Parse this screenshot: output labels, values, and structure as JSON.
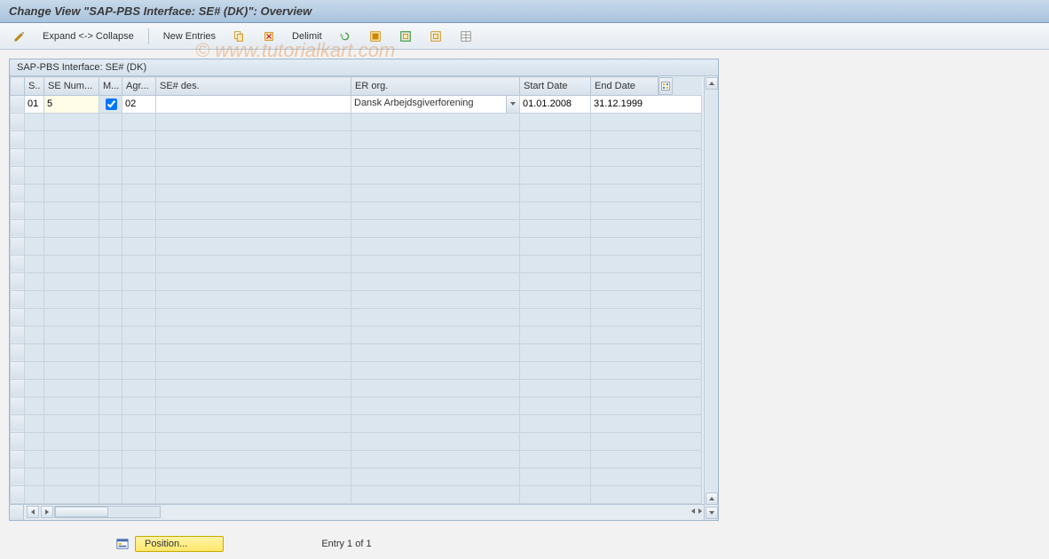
{
  "title": "Change View \"SAP-PBS Interface: SE# (DK)\": Overview",
  "toolbar": {
    "expand_collapse": "Expand <-> Collapse",
    "new_entries": "New Entries",
    "delimit": "Delimit"
  },
  "grid": {
    "title": "SAP-PBS Interface: SE# (DK)",
    "columns": [
      "S..",
      "SE Num...",
      "M...",
      "Agr...",
      "SE# des.",
      "ER org.",
      "Start Date",
      "End Date"
    ],
    "row": {
      "s": "01",
      "se_num": "5",
      "m_checked": true,
      "agr": "02",
      "se_des": "",
      "er_org": "Dansk Arbejdsgiverforening",
      "start_date": "01.01.2008",
      "end_date": "31.12.1999"
    },
    "empty_rows": 22
  },
  "footer": {
    "position_label": "Position...",
    "entry_text": "Entry 1 of 1"
  },
  "watermark": "© www.tutorialkart.com"
}
